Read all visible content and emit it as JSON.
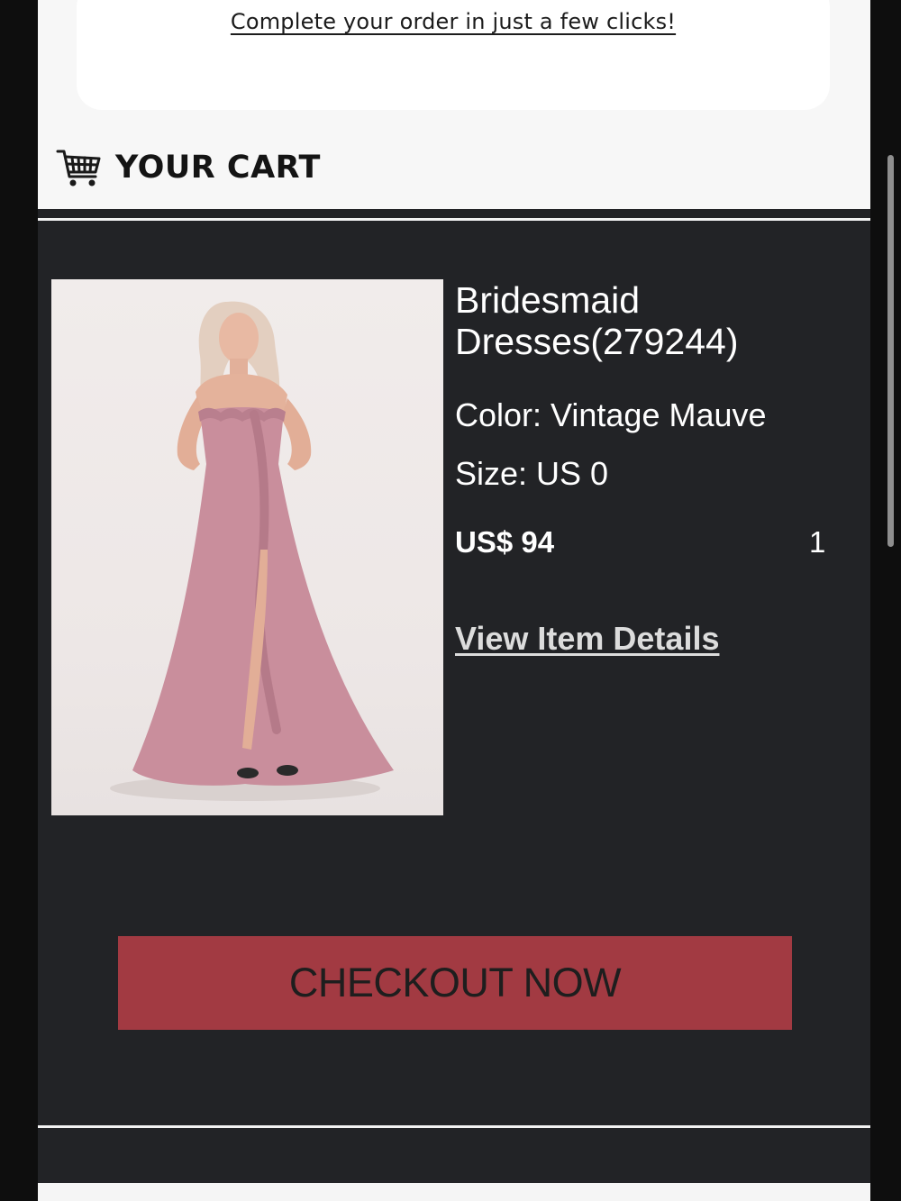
{
  "promo": {
    "link_text": "Complete your order in just a few clicks!"
  },
  "cart": {
    "title": "YOUR CART",
    "icon": "shopping-cart-icon"
  },
  "product": {
    "name": "Bridesmaid Dresses(279244)",
    "color_line": "Color: Vintage Mauve",
    "size_line": "Size: US 0",
    "price": "US$ 94",
    "quantity": "1",
    "details_link": "View Item Details",
    "image_alt": "Model wearing a strapless vintage mauve bridesmaid dress with ruffle detail and side slit"
  },
  "checkout": {
    "label": "CHECKOUT NOW",
    "button_color": "#a23a42"
  },
  "colors": {
    "email_background": "#222326",
    "top_band": "#f7f7f7",
    "dress": "#c98e9c"
  }
}
